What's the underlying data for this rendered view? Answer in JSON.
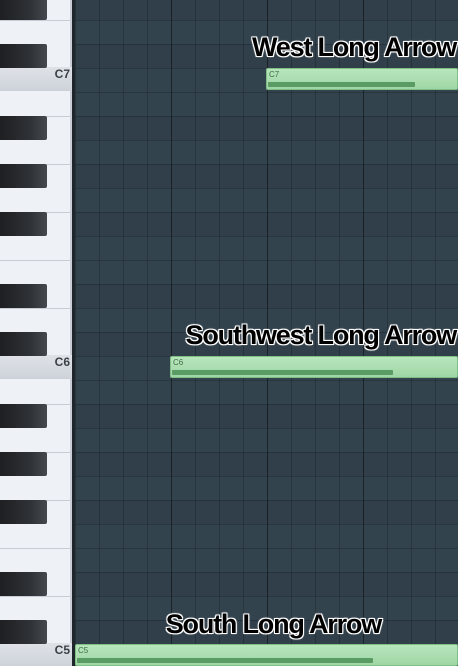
{
  "piano_roll": {
    "key_labels": {
      "c7": "C7",
      "c6": "C6",
      "c5": "C5"
    },
    "notes": [
      {
        "pitch": "C7",
        "label": "C7",
        "annotation": "West Long Arrow",
        "velocity_fraction": 0.78
      },
      {
        "pitch": "C6",
        "label": "C6",
        "annotation": "Southwest Long Arrow",
        "velocity_fraction": 0.79
      },
      {
        "pitch": "C5",
        "label": "C5",
        "annotation": "South Long Arrow",
        "velocity_fraction": 0.77
      }
    ]
  },
  "colors": {
    "grid_background": "#34444f",
    "note_fill": "#b8e6bc",
    "note_velocity_bar": "#5a9a63",
    "white_key": "#eef1f5",
    "black_key": "#2f3236"
  }
}
